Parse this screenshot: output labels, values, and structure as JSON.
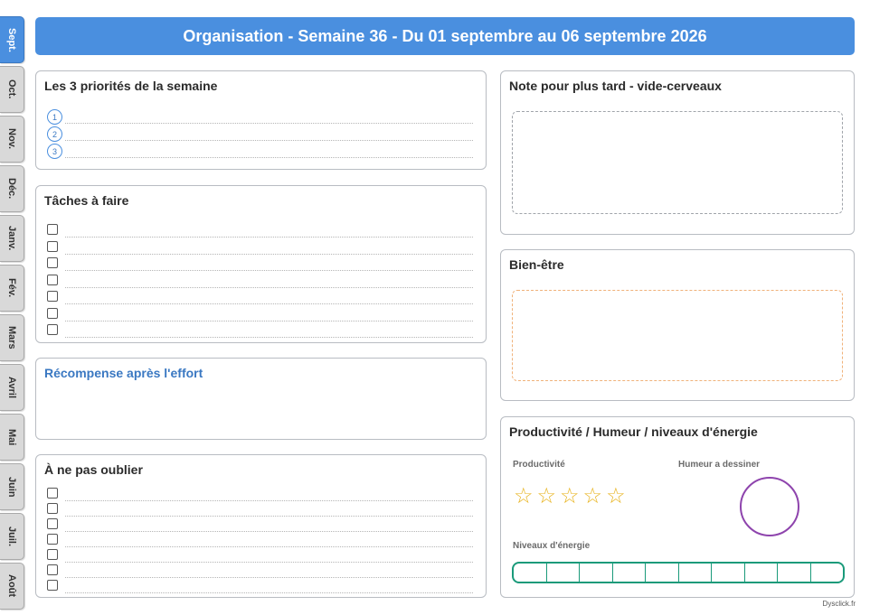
{
  "tabs": [
    "Sept.",
    "Oct.",
    "Nov.",
    "Déc.",
    "Janv.",
    "Fév.",
    "Mars",
    "Avril",
    "Mai",
    "Juin",
    "Juil.",
    "Août"
  ],
  "active_tab": 0,
  "header": {
    "title": "Organisation - Semaine 36 - Du 01 septembre au 06 septembre 2026"
  },
  "priorities": {
    "title": "Les 3 priorités de la semaine",
    "numbers": [
      "1",
      "2",
      "3"
    ]
  },
  "tasks": {
    "title": "Tâches à faire",
    "count": 7
  },
  "reward": {
    "title": "Récompense après l'effort"
  },
  "remember": {
    "title": "À ne pas oublier",
    "count": 7
  },
  "notes": {
    "title": "Note pour plus tard - vide-cerveaux"
  },
  "wellbeing": {
    "title": "Bien-être"
  },
  "productivity": {
    "title": "Productivité / Humeur / niveaux d'énergie",
    "productivity_label": "Productivité",
    "mood_label": "Humeur a dessiner",
    "energy_label": "Niveaux d'énergie",
    "stars": 5,
    "energy_segments": 10
  },
  "colors": {
    "accent": "#4a8fdf",
    "mood": "#8e44ad",
    "energy": "#1a9a7a",
    "star": "#e8b420",
    "wellbeing_dash": "#f0b27a",
    "notes_dash": "#a0a4aa"
  },
  "footer": {
    "credit": "Dysclick.fr"
  }
}
